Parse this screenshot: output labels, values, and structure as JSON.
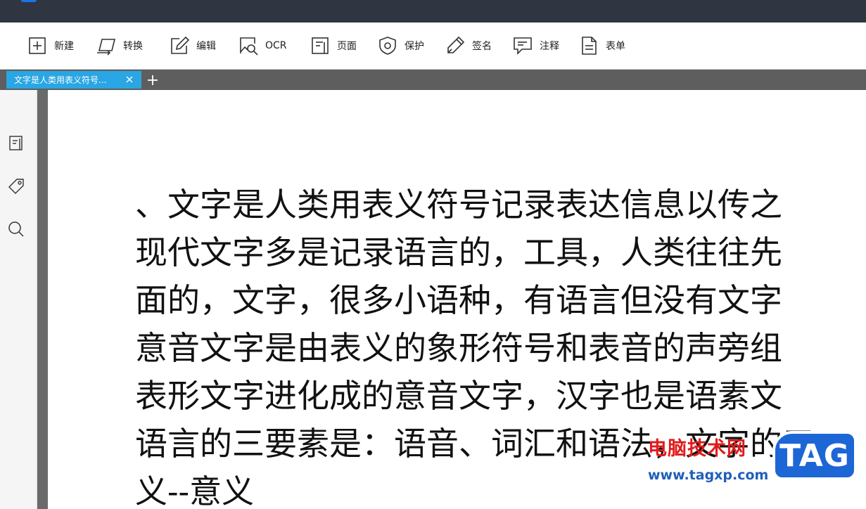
{
  "toolbar": {
    "items": [
      {
        "id": "new",
        "label": "新建",
        "icon": "add-square-icon"
      },
      {
        "id": "convert",
        "label": "转换",
        "icon": "convert-icon"
      },
      {
        "id": "edit",
        "label": "编辑",
        "icon": "edit-pen-icon"
      },
      {
        "id": "ocr",
        "label": "OCR",
        "icon": "ocr-scan-icon"
      },
      {
        "id": "page",
        "label": "页面",
        "icon": "page-icon"
      },
      {
        "id": "protect",
        "label": "保护",
        "icon": "shield-icon"
      },
      {
        "id": "sign",
        "label": "签名",
        "icon": "signature-pen-icon"
      },
      {
        "id": "comment",
        "label": "注释",
        "icon": "comment-icon"
      },
      {
        "id": "form",
        "label": "表单",
        "icon": "form-document-icon"
      }
    ]
  },
  "tabs": {
    "active": {
      "title": "文字是人类用表义符号..."
    },
    "close_symbol": "×",
    "add_symbol": "+"
  },
  "sidebar": {
    "items": [
      {
        "id": "thumbnails",
        "icon": "page-thumbnail-icon"
      },
      {
        "id": "bookmarks",
        "icon": "bookmark-tag-icon"
      },
      {
        "id": "search",
        "icon": "search-icon"
      }
    ]
  },
  "document": {
    "lines": [
      "、文字是人类用表义符号记录表达信息以传之",
      "现代文字多是记录语言的，工具，人类往往先",
      "面的，文字，很多小语种，有语言但没有文字",
      "意音文字是由表义的象形符号和表音的声旁组",
      "表形文字进化成的意音文字，汉字也是语素文",
      "语言的三要素是：语音、词汇和语法，文字的三",
      "义--意义"
    ]
  },
  "watermark": {
    "site_name": "电脑技术网",
    "url": "www.tagxp.com",
    "logo_text": "TAG"
  },
  "colors": {
    "titlebar": "#2f3541",
    "tab_active": "#29a6e3",
    "tabbar": "#5e5e5e",
    "watermark_red": "#e11b1b",
    "watermark_blue": "#1d66d6"
  }
}
